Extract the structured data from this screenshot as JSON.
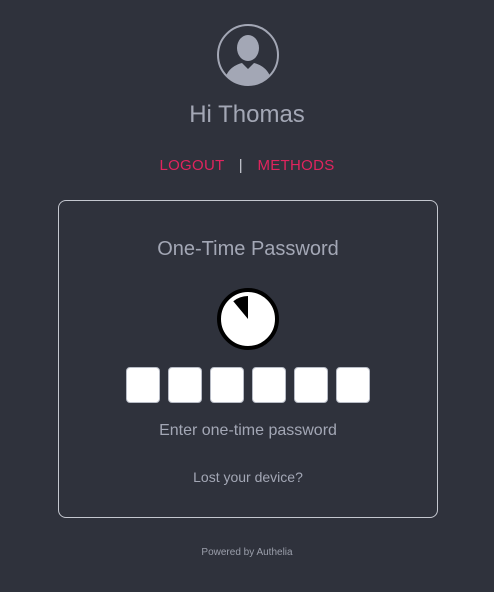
{
  "header": {
    "avatar_icon": "user-avatar-icon",
    "greeting": "Hi Thomas"
  },
  "nav": {
    "logout_label": "LOGOUT",
    "separator": "|",
    "methods_label": "METHODS",
    "accent_color": "#e0245e"
  },
  "card": {
    "title": "One-Time Password",
    "timer_icon": "countdown-timer-icon",
    "otp_digits": [
      "",
      "",
      "",
      "",
      "",
      ""
    ],
    "hint": "Enter one-time password",
    "lost_device_link": "Lost your device?"
  },
  "footer": {
    "powered_by": "Powered by Authelia"
  },
  "theme": {
    "background": "#2f323c"
  }
}
